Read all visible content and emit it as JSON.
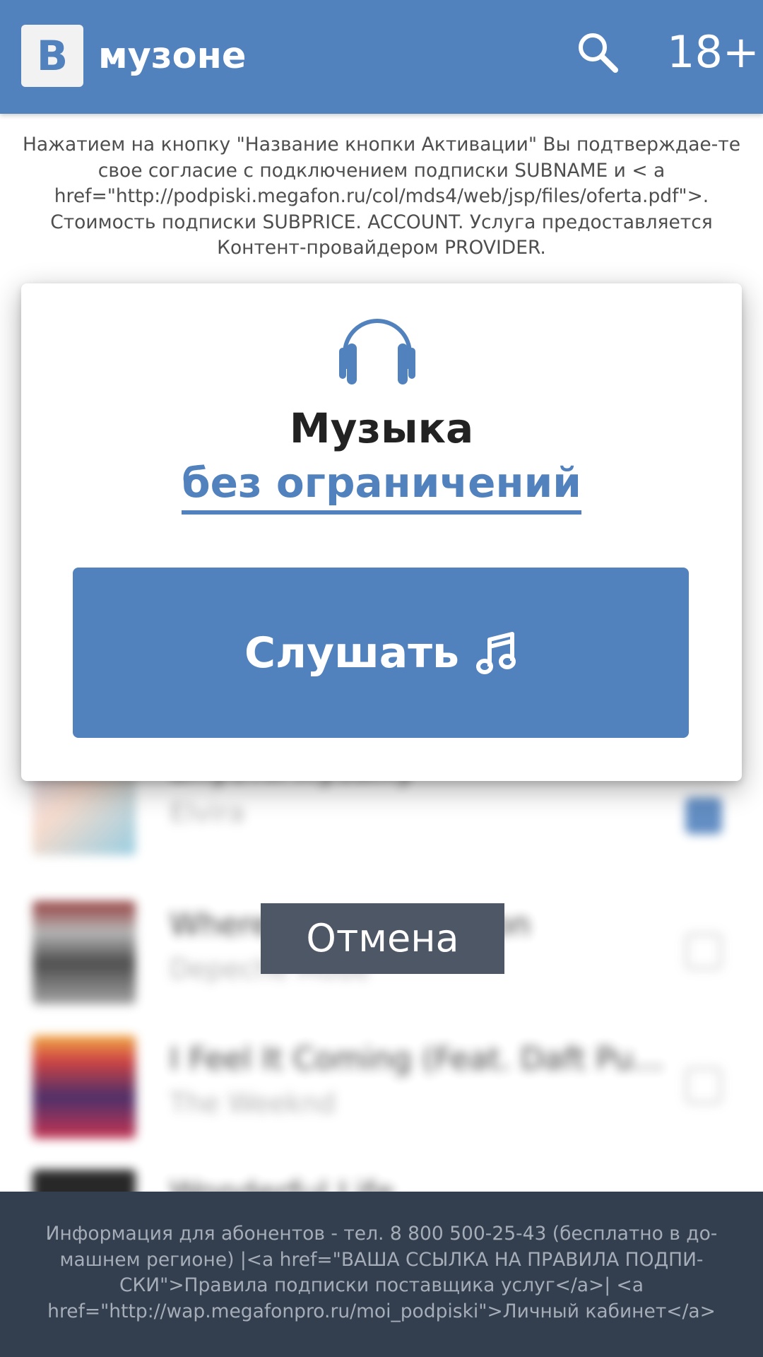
{
  "header": {
    "logo_letter": "В",
    "title": "музоне",
    "age_rating": "18+",
    "color": "#5282bd"
  },
  "disclaimer": {
    "text": "Нажатием на кнопку \"Название кнопки Активации\" Вы подтверждае-те свое согласие с подключением подписки SUBNAME и < a href=\"http://podpiski.megafon.ru/col/mds4/web/jsp/files/oferta.pdf\">. Стоимость подписки SUBPRICE. ACCOUNT. Услуга предоставляется Контент-провайдером PROVIDER."
  },
  "modal": {
    "icon": "headphones-icon",
    "title": "Музыка",
    "subtitle": "без ограничений",
    "button_label": "Слушать",
    "button_icon": "music-note-icon",
    "accent_color": "#5282bd"
  },
  "background_tracks": [
    {
      "title": "Впусти музыку",
      "artist": "Elvira",
      "checked": true
    },
    {
      "title": "Where's the Revolution",
      "artist": "Depeche Mode",
      "checked": false
    },
    {
      "title": "I Feel It Coming (Feat. Daft Pu...",
      "artist": "The Weeknd",
      "checked": false
    },
    {
      "title": "Wonderful Life",
      "artist": "",
      "checked": false
    }
  ],
  "cancel": {
    "label": "Отмена"
  },
  "footer": {
    "text": "Информация для абонентов - тел. 8 800 500-25-43 (бесплатно в до-машнем регионе) |<a href=\"ВАША ССЫЛКА НА ПРАВИЛА ПОДПИ-СКИ\">Правила подписки поставщика услуг</a>| <a href=\"http://wap.megafonpro.ru/moi_podpiski\">Личный кабинет</a>",
    "color": "#333e4e"
  }
}
